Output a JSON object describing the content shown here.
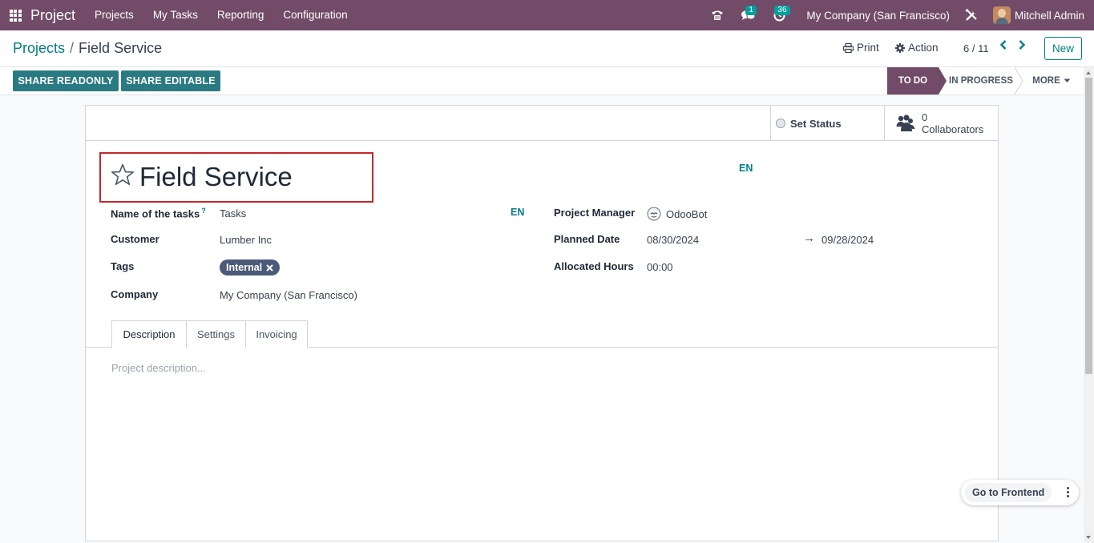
{
  "navbar": {
    "app_name": "Project",
    "menu": [
      "Projects",
      "My Tasks",
      "Reporting",
      "Configuration"
    ],
    "chat_badge": "1",
    "activity_badge": "36",
    "company": "My Company (San Francisco)",
    "user": "Mitchell Admin"
  },
  "control_panel": {
    "breadcrumb_parent": "Projects",
    "breadcrumb_separator": "/",
    "breadcrumb_current": "Field Service",
    "print_label": "Print",
    "action_label": "Action",
    "pager": "6 / 11",
    "new_label": "New"
  },
  "header": {
    "share_readonly": "SHARE READONLY",
    "share_editable": "SHARE EDITABLE",
    "stages": [
      "TO DO",
      "IN PROGRESS"
    ],
    "active_stage": "TO DO",
    "more_label": "MORE"
  },
  "button_box": {
    "set_status_label": "Set Status",
    "collaborators_count": "0",
    "collaborators_label": "Collaborators"
  },
  "form": {
    "title": "Field Service",
    "title_lang": "EN",
    "left_fields": {
      "tasks_label": "Name of the tasks",
      "tasks_help": "?",
      "tasks_value": "Tasks",
      "tasks_lang": "EN",
      "customer_label": "Customer",
      "customer_value": "Lumber Inc",
      "tags_label": "Tags",
      "tag_value": "Internal",
      "company_label": "Company",
      "company_value": "My Company (San Francisco)"
    },
    "right_fields": {
      "manager_label": "Project Manager",
      "manager_value": "OdooBot",
      "planned_label": "Planned Date",
      "planned_start": "08/30/2024",
      "planned_arrow": "→",
      "planned_end": "09/28/2024",
      "hours_label": "Allocated Hours",
      "hours_value": "00:00"
    },
    "tabs": [
      "Description",
      "Settings",
      "Invoicing"
    ],
    "active_tab": "Description",
    "description_placeholder": "Project description..."
  },
  "floating": {
    "go_frontend": "Go to Frontend"
  },
  "colors": {
    "navbar": "#714b67",
    "accent": "#017e84",
    "share_button": "#2a7a84",
    "title_highlight": "#c5272c",
    "tag": "#4c5a7a"
  }
}
